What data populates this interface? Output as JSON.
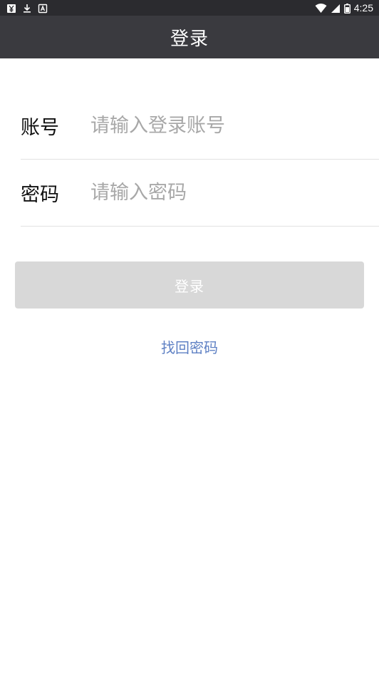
{
  "status_bar": {
    "time": "4:25",
    "left_icons": [
      "yen-notification-icon",
      "download-icon",
      "text-app-icon"
    ],
    "right_icons": [
      "wifi-icon",
      "signal-icon",
      "battery-icon"
    ]
  },
  "header": {
    "title": "登录",
    "background": "#3a3a3f"
  },
  "form": {
    "account": {
      "label": "账号",
      "placeholder": "请输入登录账号",
      "value": ""
    },
    "password": {
      "label": "密码",
      "placeholder": "请输入密码",
      "value": ""
    }
  },
  "actions": {
    "login_label": "登录",
    "login_enabled": false,
    "login_color": "#d8d8d8",
    "forgot_label": "找回密码",
    "forgot_color": "#5f81c4"
  }
}
